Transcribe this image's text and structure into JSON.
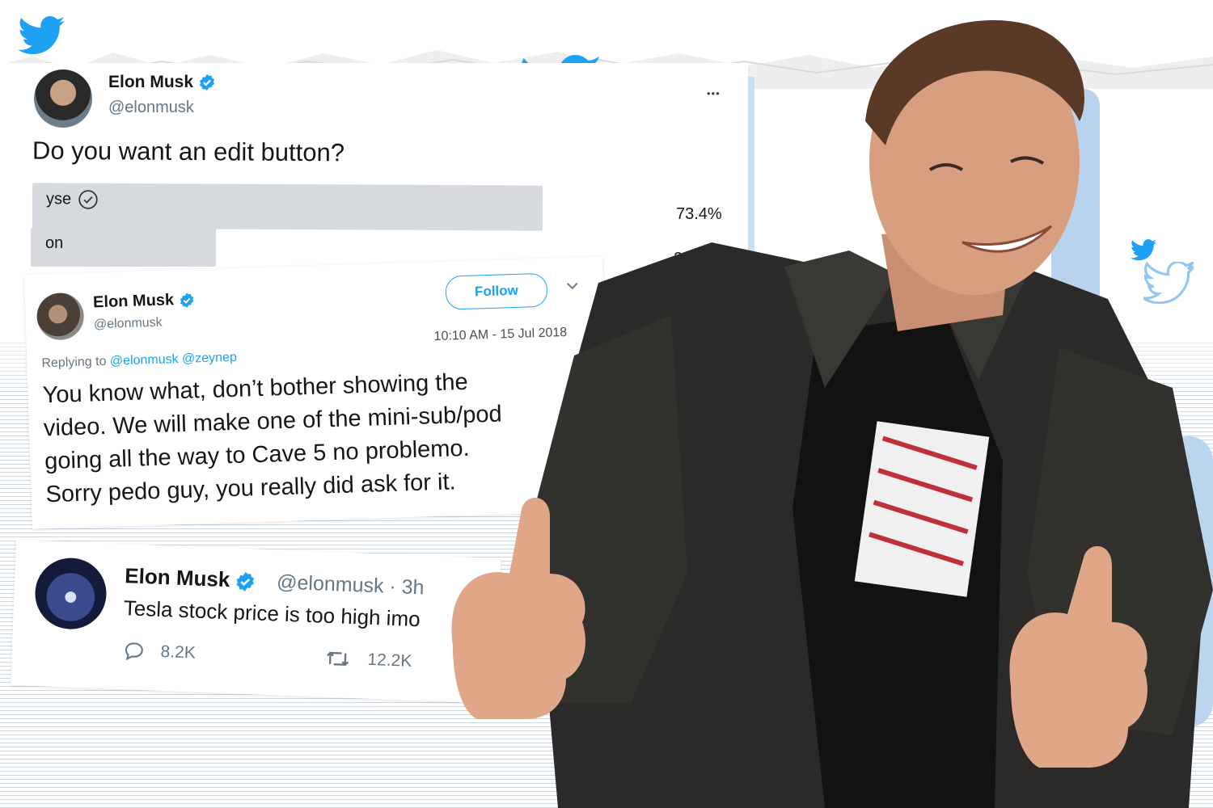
{
  "poll_tweet": {
    "name": "Elon Musk",
    "handle": "@elonmusk",
    "more_label": "•••",
    "question": "Do you want an edit button?",
    "options": [
      {
        "label": "yse",
        "percent_text": "73.4%",
        "share": 0.734,
        "selected": true
      },
      {
        "label": "on",
        "percent_text": "26.6%",
        "share": 0.266,
        "selected": false
      }
    ]
  },
  "reply_tweet": {
    "name": "Elon Musk",
    "handle": "@elonmusk",
    "follow_label": "Follow",
    "timestamp": "10:10 AM - 15 Jul 2018",
    "replying_prefix": "Replying to",
    "replying_users": "@elonmusk @zeynep",
    "lines": [
      "You know what, don’t bother showing the",
      "video. We will make one of the mini-sub/pod",
      "going all the way to Cave 5 no problemo.",
      "Sorry pedo guy, you really did ask for it."
    ]
  },
  "stock_tweet": {
    "name": "Elon Musk",
    "handle_time": "@elonmusk · 3h",
    "text": "Tesla stock price is too high imo",
    "replies": "8.2K",
    "retweets": "12.2K"
  },
  "colors": {
    "twitter_blue": "#1da1f2",
    "verified_blue": "#1da1f2",
    "jacket": "#2b2a28"
  },
  "icons": [
    "twitter-bird-icon",
    "verified-badge-icon",
    "check-circle-icon",
    "chevron-down-icon",
    "reply-icon",
    "retweet-icon",
    "more-icon"
  ]
}
